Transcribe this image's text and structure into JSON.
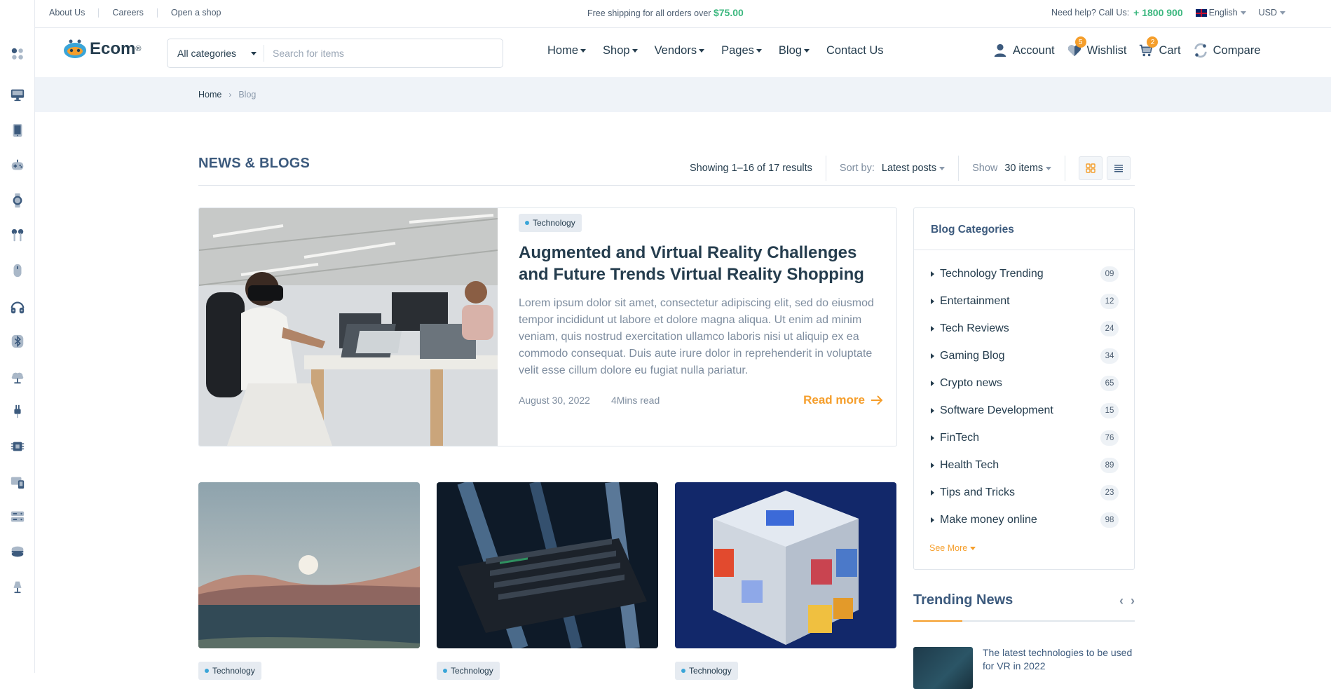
{
  "topbar": {
    "links": [
      "About Us",
      "Careers",
      "Open a shop"
    ],
    "promo_text": "Free shipping for all orders over",
    "promo_amount": "$75.00",
    "help_text": "Need help? Call Us:",
    "phone": "+ 1800 900",
    "language": "English",
    "currency": "USD"
  },
  "header": {
    "logo": "Ecom",
    "logo_mark": "®",
    "search_category": "All categories",
    "search_placeholder": "Search for items",
    "nav": [
      "Home",
      "Shop",
      "Vendors",
      "Pages",
      "Blog",
      "Contact Us"
    ],
    "account": "Account",
    "wishlist": "Wishlist",
    "wishlist_count": "5",
    "cart": "Cart",
    "cart_count": "2",
    "compare": "Compare"
  },
  "breadcrumb": {
    "home": "Home",
    "current": "Blog"
  },
  "main": {
    "title": "NEWS & BLOGS",
    "showing": "Showing 1–16 of 17 results",
    "sort_label": "Sort by:",
    "sort_value": "Latest posts",
    "show_label": "Show",
    "show_value": "30 items"
  },
  "featured": {
    "tag": "Technology",
    "title": "Augmented and Virtual Reality Challenges and Future Trends Virtual Reality Shopping",
    "excerpt": "Lorem ipsum dolor sit amet, consectetur adipiscing elit, sed do eiusmod tempor incididunt ut labore et dolore magna aliqua. Ut enim ad minim veniam, quis nostrud exercitation ullamco laboris nisi ut aliquip ex ea commodo consequat. Duis aute irure dolor in reprehenderit in voluptate velit esse cillum dolore eu fugiat nulla pariatur.",
    "date": "August 30, 2022",
    "read_time": "4Mins read",
    "read_more": "Read more"
  },
  "cards": [
    {
      "tag": "Technology"
    },
    {
      "tag": "Technology"
    },
    {
      "tag": "Technology"
    }
  ],
  "sidebar": {
    "title": "Blog Categories",
    "items": [
      {
        "label": "Technology Trending",
        "count": "09"
      },
      {
        "label": "Entertainment",
        "count": "12"
      },
      {
        "label": "Tech Reviews",
        "count": "24"
      },
      {
        "label": "Gaming Blog",
        "count": "34"
      },
      {
        "label": "Crypto news",
        "count": "65"
      },
      {
        "label": "Software Development",
        "count": "15"
      },
      {
        "label": "FinTech",
        "count": "76"
      },
      {
        "label": "Health Tech",
        "count": "89"
      },
      {
        "label": "Tips and Tricks",
        "count": "23"
      },
      {
        "label": "Make money online",
        "count": "98"
      }
    ],
    "see_more": "See More"
  },
  "trending": {
    "title": "Trending News",
    "item_title": "The latest technologies to be used for VR in 2022"
  },
  "rail_icons": [
    "apps-icon",
    "monitor-icon",
    "tablet-icon",
    "gamepad-icon",
    "watch-icon",
    "earbuds-icon",
    "mouse-icon",
    "headphones-icon",
    "bluetooth-icon",
    "lamp-icon",
    "plug-icon",
    "chip-icon",
    "devices-icon",
    "server-icon",
    "hdd-icon",
    "desk-lamp-icon"
  ],
  "colors": {
    "accent": "#f59e2b",
    "green": "#3bb77e",
    "heading": "#3c5a7d",
    "text": "#253d4e"
  }
}
